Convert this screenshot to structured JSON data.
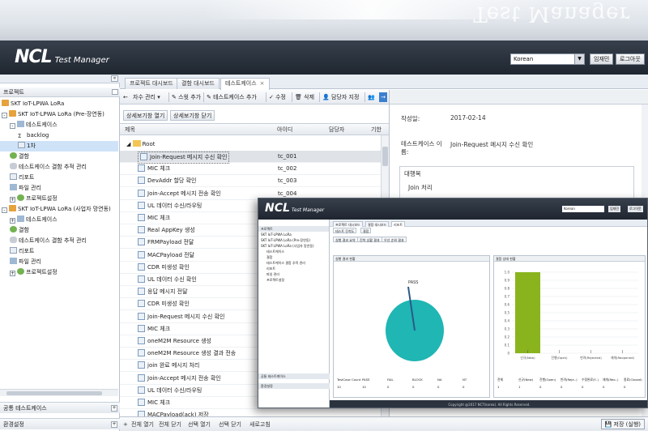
{
  "app": {
    "name": "NCL",
    "subtitle": "Test Manager",
    "watermark": "Test Manager",
    "language": "Korean",
    "btn_info": "임재민",
    "btn_logout": "로그아웃"
  },
  "left_panel": {
    "title": "프로젝트",
    "tree": [
      {
        "label": "SKT IoT-LPWA LoRa",
        "indent": 0,
        "icon": "home-icon",
        "toggle": ""
      },
      {
        "label": "SKT IoT-LPWA LoRa (Pre-장연동)",
        "indent": 0,
        "icon": "home-icon",
        "toggle": "-"
      },
      {
        "label": "테스트케이스",
        "indent": 1,
        "icon": "folder-icon",
        "toggle": "-"
      },
      {
        "label": "backlog",
        "indent": 2,
        "icon": "sigma-icon",
        "toggle": ""
      },
      {
        "label": "1차",
        "indent": 2,
        "icon": "doc-icon",
        "toggle": "",
        "selected": true
      },
      {
        "label": "결함",
        "indent": 1,
        "icon": "gear-icon",
        "toggle": ""
      },
      {
        "label": "테스트케이스 결함 추적 관리",
        "indent": 1,
        "icon": "link-icon",
        "toggle": ""
      },
      {
        "label": "리포트",
        "indent": 1,
        "icon": "doc-icon",
        "toggle": ""
      },
      {
        "label": "파일 관리",
        "indent": 1,
        "icon": "folder-icon",
        "toggle": ""
      },
      {
        "label": "프로젝트설정",
        "indent": 1,
        "icon": "gear-icon",
        "toggle": "+"
      },
      {
        "label": "SKT IoT-LPWA LoRa (사업자 망연동)",
        "indent": 0,
        "icon": "home-icon",
        "toggle": "-"
      },
      {
        "label": "테스트케이스",
        "indent": 1,
        "icon": "folder-icon",
        "toggle": "+"
      },
      {
        "label": "결함",
        "indent": 1,
        "icon": "gear-icon",
        "toggle": ""
      },
      {
        "label": "테스트케이스 결함 추적 관리",
        "indent": 1,
        "icon": "link-icon",
        "toggle": ""
      },
      {
        "label": "리포트",
        "indent": 1,
        "icon": "doc-icon",
        "toggle": ""
      },
      {
        "label": "파일 관리",
        "indent": 1,
        "icon": "folder-icon",
        "toggle": ""
      },
      {
        "label": "프로젝트설정",
        "indent": 1,
        "icon": "gear-icon",
        "toggle": "+"
      }
    ],
    "footer1": "공통 테스트케이스",
    "footer2": "환경설정"
  },
  "tabs": [
    {
      "label": "프로젝트 대시보드"
    },
    {
      "label": "결함 대시보드"
    },
    {
      "label": "테스트케이스",
      "active": true
    }
  ],
  "toolbar": {
    "item1": "자수 관리",
    "item2": "스윗 추가",
    "item3": "테스트케이스 추가",
    "item4": "수정",
    "item5": "삭제",
    "item6": "담당자 지정"
  },
  "subbar": {
    "open_detail": "상세보기창 열기",
    "close_detail": "상세보기창 닫기"
  },
  "grid": {
    "col_title": "제목",
    "col_id": "아이디",
    "col_owner": "담당자",
    "col_due": "기한",
    "root": "Root",
    "rows": [
      {
        "title": "Join-Request 메시지 수신 확인",
        "id": "tc_001",
        "selected": true
      },
      {
        "title": "MIC 체크",
        "id": "tc_002"
      },
      {
        "title": "DevAddr 할당 확인",
        "id": "tc_003"
      },
      {
        "title": "Join-Accept 메시지 전송 확인",
        "id": "tc_004"
      },
      {
        "title": "UL 데이터 수신/라우팅",
        "id": ""
      },
      {
        "title": "MIC 체크",
        "id": ""
      },
      {
        "title": "Real AppKey 생성",
        "id": ""
      },
      {
        "title": "FRMPayload 전달",
        "id": ""
      },
      {
        "title": "MACPayload 전달",
        "id": ""
      },
      {
        "title": "CDR 미생성 확인",
        "id": ""
      },
      {
        "title": "UL 데이터 수신 확인",
        "id": ""
      },
      {
        "title": "응답 메시지 전달",
        "id": ""
      },
      {
        "title": "CDR 미생성 확인",
        "id": ""
      },
      {
        "title": "Join-Request 메시지 수신 확인",
        "id": ""
      },
      {
        "title": "MIC 체크",
        "id": ""
      },
      {
        "title": "oneM2M Resource 생성",
        "id": ""
      },
      {
        "title": "oneM2M Resource 생성 결과 전송",
        "id": ""
      },
      {
        "title": "join 완료 메시지 처리",
        "id": ""
      },
      {
        "title": "Join-Accept 메시지 전송 확인",
        "id": ""
      },
      {
        "title": "UL 데이터 수신/라우팅",
        "id": ""
      },
      {
        "title": "MIC 체크",
        "id": ""
      },
      {
        "title": "MACPayload(ack) 저장",
        "id": ""
      }
    ]
  },
  "bottom_bar": {
    "expand_all": "전체 열기",
    "collapse_all": "전체 닫기",
    "open_selected": "선택 열기",
    "close_selected": "선택 닫기",
    "refresh": "새로고침",
    "save": "저장 (실행)"
  },
  "detail": {
    "created_label": "작성일:",
    "created_value": "2017-02-14",
    "name_label": "테스트케이스 이름:",
    "name_value": "Join-Request 메시지 수신 확인",
    "target_label": "대행목",
    "target_value": "Join 처리"
  },
  "overlay": {
    "language": "Korean",
    "tabs": [
      "프로젝트 대시보드",
      "결함 대시보드",
      "리포트"
    ],
    "sub_tabs": [
      "테스트 진척도",
      "결함"
    ],
    "sub_btns": [
      "실행 결과 요약",
      "진척 상황 결과",
      "우선 순위 결과"
    ],
    "panel_left_title": "실행 결과 현황",
    "panel_right_title": "결함 상태 현황",
    "pie_label": "PASS",
    "table_headers": [
      "TestCase Count",
      "PASS",
      "FAIL",
      "BLOCK",
      "NA",
      "NT"
    ],
    "table_values": [
      "10",
      "10",
      "0",
      "0",
      "0",
      "0"
    ],
    "right_headers": [
      "전체",
      "신규(New)",
      "진행(Open)",
      "반려(Reje..)",
      "수정완료(F..)",
      "재개(Reo..)",
      "종료(Closed)"
    ],
    "right_values": [
      "1",
      "1",
      "0",
      "0",
      "0",
      "0",
      "0"
    ],
    "copyright": "Copyright @2017 NCT(korea). All Rights Reserved.",
    "tree": [
      "SKT IoT-LPWA LoRa",
      "SKT IoT-LPWA LoRa (Pre-장연동)",
      "SKT IoT-LPWA LoRa (사업자 망연동)",
      "테스트케이스",
      "결함",
      "테스트케이스 결함 추적 관리",
      "리포트",
      "파일 관리",
      "프로젝트설정"
    ],
    "left_footer": "공통 테스트케이스",
    "left_footer2": "환경설정"
  },
  "overlay_chart": {
    "type": "bar",
    "ylim": [
      0,
      1.0
    ],
    "yticks": [
      "0",
      "0.1",
      "0.2",
      "0.3",
      "0.4",
      "0.5",
      "0.6",
      "0.7",
      "0.8",
      "0.9",
      "1.0"
    ],
    "categories": [
      "신규(New)",
      "진행(Open)",
      "반려(Rejected)",
      "재개(Reopened)"
    ],
    "values": [
      1,
      0,
      0,
      0
    ]
  },
  "colors": {
    "header_dark": "#1f2630",
    "selection": "#cfe3f8",
    "pie_fill": "#1fb6b4",
    "bar_fill": "#8ab41e"
  }
}
